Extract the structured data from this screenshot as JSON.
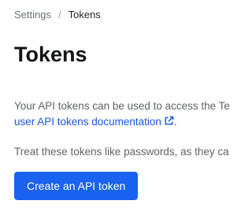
{
  "breadcrumb": {
    "items": [
      {
        "label": "Settings"
      },
      {
        "label": "Tokens"
      }
    ],
    "separator": "/"
  },
  "page": {
    "title": "Tokens"
  },
  "intro": {
    "line1": "Your API tokens can be used to access the Te",
    "link_label": "user API tokens documentation",
    "link_suffix": ".",
    "link_icon": "external-link-icon"
  },
  "warning": {
    "text": "Treat these tokens like passwords, as they ca"
  },
  "actions": {
    "create_label": "Create an API token"
  },
  "colors": {
    "accent": "#1a63f0",
    "link": "#1a57e0",
    "text_muted": "#5f6368"
  }
}
